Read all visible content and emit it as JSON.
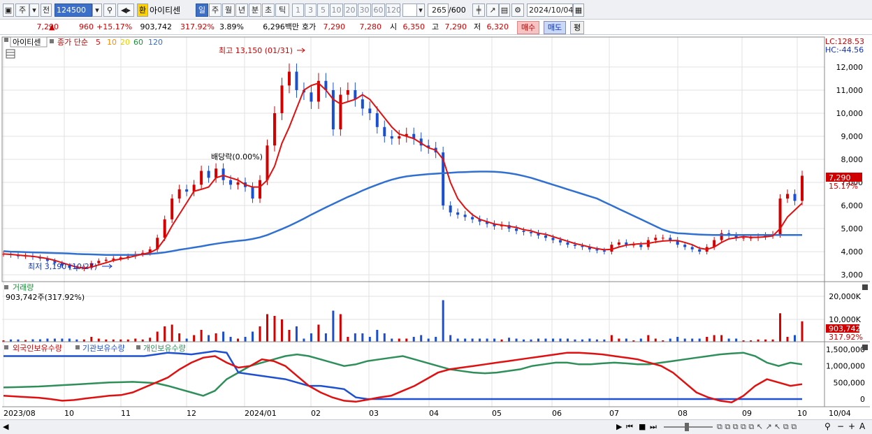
{
  "toolbar": {
    "market": "주",
    "prev": "전",
    "code": "124500",
    "name": "아이티센",
    "hwan": "환",
    "periods": [
      "일",
      "주",
      "월",
      "년",
      "분",
      "초",
      "틱"
    ],
    "intervals": [
      "1",
      "3",
      "5",
      "10",
      "20",
      "30",
      "60",
      "120"
    ],
    "count": "265",
    "count_max": "/600",
    "date": "2024/10/04"
  },
  "quote": {
    "price": "7,290",
    "change": "960",
    "change_rate": "+15.17%",
    "volume": "903,742",
    "vol_rate": "317.92%",
    "turnover_rate": "3.89%",
    "amount": "6,296백만",
    "hoga_label": "호가",
    "ask": "7,290",
    "bid": "7,280",
    "open_label": "시",
    "open": "6,350",
    "high_label": "고",
    "high": "7,290",
    "low_label": "저",
    "low": "6,320",
    "buy_btn": "매수",
    "sell_btn": "매도",
    "eval_btn": "평"
  },
  "legend": {
    "name": "아이티센",
    "ma_label": "종가 단순",
    "ma": [
      "5",
      "10",
      "20",
      "60",
      "120"
    ]
  },
  "annot": {
    "high": "최고 13,150 (01/31)",
    "low": "최저 3,190 (10/27)",
    "ex": "배당락(0.00%)",
    "lc": "LC:128.53",
    "hc": "HC:-44.56",
    "last_price": "7,290",
    "last_rate": "15.17%",
    "last_vol": "903,742",
    "last_vol_rate": "317.92%"
  },
  "volume_panel": {
    "title": "거래량",
    "value": "903,742주(317.92%)"
  },
  "holding_panel": {
    "s1": "외국인보유수량",
    "s2": "기관보유수량",
    "s3": "개인보유수량"
  },
  "axes": {
    "price_ticks": [
      "12,000",
      "11,000",
      "10,000",
      "9,000",
      "8,000",
      "7,000",
      "6,000",
      "5,000",
      "4,000",
      "3,000"
    ],
    "volume_ticks": [
      "20,000K",
      "10,000K"
    ],
    "holding_ticks": [
      "1,500,000",
      "1,000,000",
      "500,000",
      "0"
    ],
    "x_labels": [
      "2023/08",
      "10",
      "11",
      "12",
      "2024/01",
      "02",
      "03",
      "04",
      "05",
      "06",
      "07",
      "08",
      "09",
      "10",
      "10/04"
    ]
  },
  "chart_data": {
    "type": "candlestick",
    "title": "아이티센 124500 일봉",
    "ylim": [
      2700,
      13300
    ],
    "price_close": [
      3900,
      3850,
      3800,
      3820,
      3760,
      3700,
      3600,
      3500,
      3400,
      3300,
      3250,
      3300,
      3500,
      3600,
      3650,
      3700,
      3750,
      3800,
      3900,
      3950,
      4100,
      4600,
      5400,
      6300,
      6700,
      6600,
      6900,
      7500,
      7200,
      7600,
      7100,
      6900,
      7000,
      6800,
      6300,
      7100,
      8600,
      10000,
      11200,
      11800,
      11000,
      10900,
      10500,
      11400,
      11000,
      9300,
      10800,
      11000,
      10600,
      10200,
      10000,
      9400,
      9000,
      8900,
      9000,
      9100,
      8900,
      8600,
      8500,
      8300,
      6000,
      5700,
      5600,
      5500,
      5400,
      5300,
      5200,
      5100,
      5150,
      5000,
      4900,
      4850,
      4800,
      4700,
      4600,
      4500,
      4400,
      4300,
      4250,
      4200,
      4100,
      4050,
      4000,
      4300,
      4400,
      4300,
      4300,
      4200,
      4500,
      4600,
      4600,
      4500,
      4300,
      4200,
      4100,
      4000,
      4200,
      4500,
      4800,
      4700,
      4600,
      4600,
      4600,
      4650,
      4700,
      4750,
      6300,
      6500,
      6200,
      7290
    ],
    "ma5": [
      3900,
      3880,
      3850,
      3820,
      3800,
      3750,
      3700,
      3620,
      3520,
      3420,
      3330,
      3290,
      3330,
      3430,
      3520,
      3620,
      3680,
      3740,
      3820,
      3890,
      3960,
      4120,
      4550,
      5120,
      5620,
      6120,
      6620,
      6700,
      6800,
      7200,
      7300,
      7200,
      7100,
      6900,
      6800,
      6800,
      7100,
      7700,
      8700,
      9400,
      10200,
      11000,
      11200,
      11300,
      11000,
      10600,
      10400,
      10500,
      10600,
      10800,
      10600,
      10200,
      9800,
      9400,
      9100,
      9000,
      8900,
      8700,
      8500,
      8400,
      8000,
      7000,
      6300,
      5900,
      5600,
      5400,
      5300,
      5200,
      5150,
      5100,
      5050,
      4950,
      4900,
      4800,
      4750,
      4650,
      4550,
      4450,
      4350,
      4280,
      4200,
      4130,
      4080,
      4100,
      4200,
      4280,
      4320,
      4340,
      4360,
      4420,
      4460,
      4480,
      4480,
      4400,
      4300,
      4150,
      4100,
      4200,
      4400,
      4550,
      4600,
      4650,
      4620,
      4620,
      4640,
      4680,
      5000,
      5500,
      5800,
      6100
    ],
    "ma120": [
      4020,
      4000,
      3990,
      3980,
      3970,
      3960,
      3950,
      3940,
      3930,
      3920,
      3900,
      3890,
      3880,
      3870,
      3860,
      3860,
      3860,
      3860,
      3860,
      3880,
      3900,
      3930,
      3970,
      4020,
      4080,
      4130,
      4180,
      4230,
      4290,
      4340,
      4390,
      4430,
      4470,
      4500,
      4550,
      4620,
      4720,
      4850,
      4980,
      5120,
      5270,
      5430,
      5600,
      5760,
      5920,
      6070,
      6220,
      6370,
      6500,
      6650,
      6780,
      6900,
      7020,
      7120,
      7200,
      7260,
      7300,
      7330,
      7360,
      7380,
      7400,
      7420,
      7440,
      7450,
      7460,
      7470,
      7470,
      7460,
      7440,
      7400,
      7350,
      7280,
      7200,
      7100,
      7000,
      6900,
      6800,
      6700,
      6600,
      6500,
      6400,
      6300,
      6150,
      6000,
      5850,
      5700,
      5550,
      5400,
      5250,
      5100,
      4950,
      4850,
      4800,
      4780,
      4760,
      4740,
      4730,
      4720,
      4720,
      4720,
      4720,
      4720,
      4720,
      4720,
      4720,
      4720,
      4720,
      4720,
      4720,
      4720
    ],
    "holding_foreign": [
      100000,
      80000,
      60000,
      40000,
      0,
      -50000,
      -30000,
      20000,
      60000,
      100000,
      120000,
      200000,
      350000,
      500000,
      650000,
      900000,
      1100000,
      1250000,
      1300000,
      1100000,
      950000,
      1000000,
      1200000,
      1150000,
      1000000,
      700000,
      400000,
      200000,
      50000,
      -50000,
      -80000,
      -20000,
      50000,
      100000,
      250000,
      400000,
      600000,
      800000,
      900000,
      950000,
      1000000,
      1050000,
      1100000,
      1150000,
      1200000,
      1250000,
      1300000,
      1350000,
      1400000,
      1400000,
      1380000,
      1350000,
      1300000,
      1250000,
      1200000,
      1100000,
      1000000,
      800000,
      500000,
      200000,
      50000,
      -50000,
      -100000,
      100000,
      400000,
      600000,
      500000,
      400000,
      450000
    ],
    "holding_institution": [
      1300000,
      1300000,
      1300000,
      1300000,
      1300000,
      1300000,
      1300000,
      1300000,
      1300000,
      1300000,
      1300000,
      1300000,
      1300000,
      1350000,
      1400000,
      1380000,
      1350000,
      1400000,
      1450000,
      1400000,
      800000,
      750000,
      700000,
      650000,
      600000,
      500000,
      400000,
      400000,
      350000,
      300000,
      50000,
      0,
      0,
      0,
      0,
      0,
      0,
      0,
      0,
      0,
      0,
      0,
      0,
      0,
      0,
      0,
      0,
      0,
      0,
      0,
      0,
      0,
      0,
      0,
      0,
      0,
      0,
      0,
      0,
      0,
      0,
      0,
      0,
      0,
      0,
      0,
      0,
      0,
      0
    ],
    "holding_individual": [
      350000,
      360000,
      370000,
      380000,
      400000,
      420000,
      440000,
      460000,
      480000,
      500000,
      510000,
      520000,
      500000,
      480000,
      400000,
      300000,
      200000,
      100000,
      250000,
      600000,
      800000,
      1000000,
      1100000,
      1200000,
      1300000,
      1350000,
      1300000,
      1200000,
      1100000,
      1000000,
      1050000,
      1150000,
      1200000,
      1250000,
      1300000,
      1200000,
      1100000,
      1000000,
      900000,
      850000,
      800000,
      780000,
      800000,
      850000,
      900000,
      1000000,
      1050000,
      1100000,
      1100000,
      1050000,
      1050000,
      1080000,
      1100000,
      1080000,
      1050000,
      1050000,
      1100000,
      1150000,
      1200000,
      1250000,
      1300000,
      1350000,
      1380000,
      1400000,
      1300000,
      1100000,
      1000000,
      1100000,
      1050000
    ]
  }
}
